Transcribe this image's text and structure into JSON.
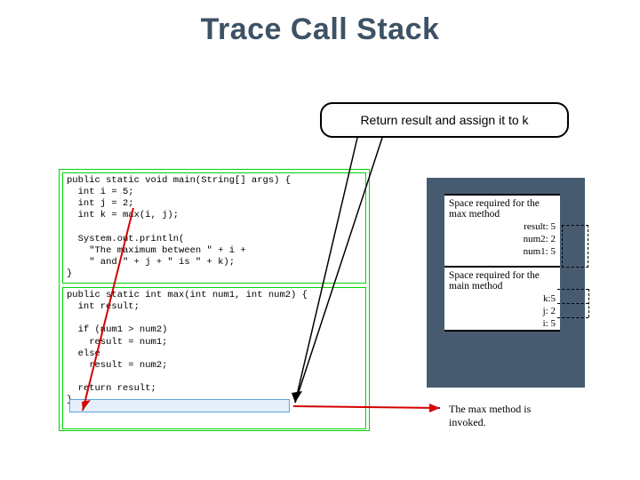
{
  "title": "Trace Call Stack",
  "callout_text": "Return result and assign it to k",
  "code_main": "public static void main(String[] args) {\n  int i = 5;\n  int j = 2;\n  int k = max(i, j);\n\n  System.out.println(\n    \"The maximum between \" + i +\n    \" and \" + j + \" is \" + k);\n}",
  "code_max": "public static int max(int num1, int num2) {\n  int result;\n\n  if (num1 > num2)\n    result = num1;\n  else\n    result = num2;\n\n  return result;\n}",
  "stack_max_label": "Space required for the max method",
  "stack_max_vars": "result: 5\nnum2: 2\nnum1: 5",
  "stack_main_label": "Space required for the main method",
  "stack_main_vars": "k:5\nj: 2\ni: 5",
  "invoked_text": "The max method is invoked."
}
